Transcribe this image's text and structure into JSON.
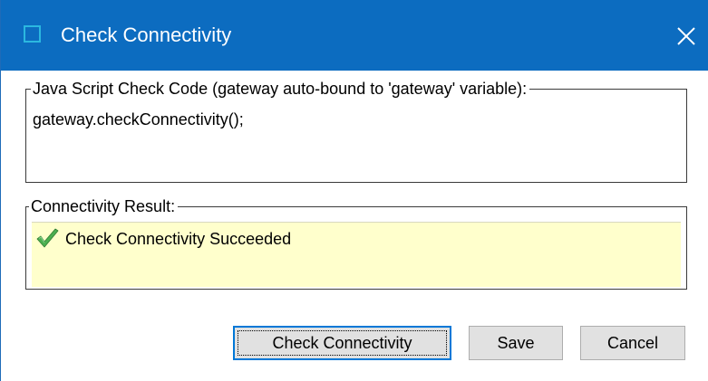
{
  "window": {
    "title": "Check Connectivity",
    "title_bar_color": "#0c6cc0",
    "app_icon": "window-frame-icon",
    "close_icon": "close-x-icon"
  },
  "code_group": {
    "legend": "Java Script Check Code (gateway auto-bound to 'gateway' variable):",
    "code": "gateway.checkConnectivity();"
  },
  "result_group": {
    "legend": "Connectivity Result:",
    "status_icon": "green-checkmark-icon",
    "status_text": "Check Connectivity Succeeded",
    "background_color": "#ffffcc",
    "status_icon_color": "#4caf50"
  },
  "buttons": {
    "check_label": "Check Connectivity",
    "save_label": "Save",
    "cancel_label": "Cancel",
    "focus_color": "#0078d7"
  }
}
